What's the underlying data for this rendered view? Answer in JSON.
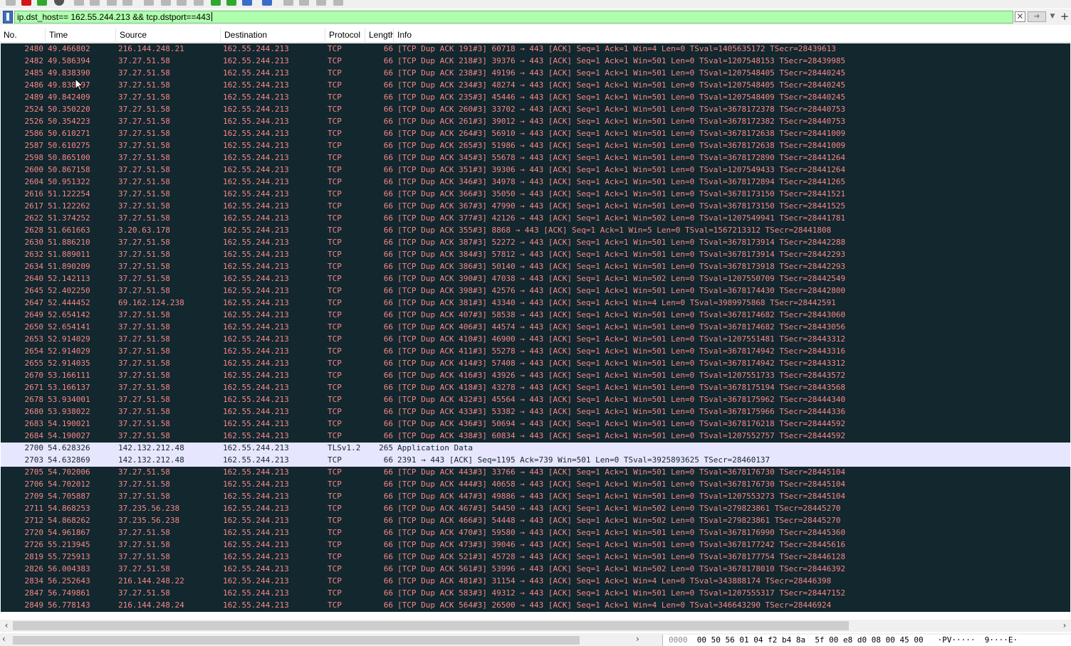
{
  "filter": {
    "value": "ip.dst_host== 162.55.244.213 && tcp.dstport==443",
    "bookmark_icon": "bookmark-icon",
    "clear_icon": "clear-icon",
    "apply_icon": "arrow-right-icon",
    "dropdown_icon": "chevron-down-icon",
    "add_icon": "plus-icon",
    "color": "#afffaf"
  },
  "columns": [
    "No.",
    "Time",
    "Source",
    "Destination",
    "Protocol",
    "Length",
    "Info"
  ],
  "colors": {
    "bad_tcp_bg": "#12272e",
    "bad_tcp_fg": "#f78787",
    "normal_bg": "#e7e6ff",
    "normal_fg": "#12272e"
  },
  "packets": [
    {
      "no": "2480",
      "time": "49.466802",
      "src": "216.144.248.21",
      "dst": "162.55.244.213",
      "proto": "TCP",
      "len": "66",
      "info": "[TCP Dup ACK 191#3] 60718 → 443 [ACK] Seq=1 Ack=1 Win=4 Len=0 TSval=1405635172 TSecr=28439613",
      "style": "bad"
    },
    {
      "no": "2482",
      "time": "49.586394",
      "src": "37.27.51.58",
      "dst": "162.55.244.213",
      "proto": "TCP",
      "len": "66",
      "info": "[TCP Dup ACK 218#3] 39376 → 443 [ACK] Seq=1 Ack=1 Win=501 Len=0 TSval=1207548153 TSecr=28439985",
      "style": "bad"
    },
    {
      "no": "2485",
      "time": "49.838390",
      "src": "37.27.51.58",
      "dst": "162.55.244.213",
      "proto": "TCP",
      "len": "66",
      "info": "[TCP Dup ACK 238#3] 49196 → 443 [ACK] Seq=1 Ack=1 Win=501 Len=0 TSval=1207548405 TSecr=28440245",
      "style": "bad"
    },
    {
      "no": "2486",
      "time": "49.838397",
      "src": "37.27.51.58",
      "dst": "162.55.244.213",
      "proto": "TCP",
      "len": "66",
      "info": "[TCP Dup ACK 234#3] 48274 → 443 [ACK] Seq=1 Ack=1 Win=501 Len=0 TSval=1207548405 TSecr=28440245",
      "style": "bad"
    },
    {
      "no": "2489",
      "time": "49.842409",
      "src": "37.27.51.58",
      "dst": "162.55.244.213",
      "proto": "TCP",
      "len": "66",
      "info": "[TCP Dup ACK 235#3] 45446 → 443 [ACK] Seq=1 Ack=1 Win=501 Len=0 TSval=1207548409 TSecr=28440245",
      "style": "bad"
    },
    {
      "no": "2524",
      "time": "50.350220",
      "src": "37.27.51.58",
      "dst": "162.55.244.213",
      "proto": "TCP",
      "len": "66",
      "info": "[TCP Dup ACK 260#3] 33702 → 443 [ACK] Seq=1 Ack=1 Win=501 Len=0 TSval=3678172378 TSecr=28440753",
      "style": "bad"
    },
    {
      "no": "2526",
      "time": "50.354223",
      "src": "37.27.51.58",
      "dst": "162.55.244.213",
      "proto": "TCP",
      "len": "66",
      "info": "[TCP Dup ACK 261#3] 39012 → 443 [ACK] Seq=1 Ack=1 Win=501 Len=0 TSval=3678172382 TSecr=28440753",
      "style": "bad"
    },
    {
      "no": "2586",
      "time": "50.610271",
      "src": "37.27.51.58",
      "dst": "162.55.244.213",
      "proto": "TCP",
      "len": "66",
      "info": "[TCP Dup ACK 264#3] 56910 → 443 [ACK] Seq=1 Ack=1 Win=501 Len=0 TSval=3678172638 TSecr=28441009",
      "style": "bad"
    },
    {
      "no": "2587",
      "time": "50.610275",
      "src": "37.27.51.58",
      "dst": "162.55.244.213",
      "proto": "TCP",
      "len": "66",
      "info": "[TCP Dup ACK 265#3] 51986 → 443 [ACK] Seq=1 Ack=1 Win=501 Len=0 TSval=3678172638 TSecr=28441009",
      "style": "bad"
    },
    {
      "no": "2598",
      "time": "50.865100",
      "src": "37.27.51.58",
      "dst": "162.55.244.213",
      "proto": "TCP",
      "len": "66",
      "info": "[TCP Dup ACK 345#3] 55678 → 443 [ACK] Seq=1 Ack=1 Win=501 Len=0 TSval=3678172890 TSecr=28441264",
      "style": "bad"
    },
    {
      "no": "2600",
      "time": "50.867158",
      "src": "37.27.51.58",
      "dst": "162.55.244.213",
      "proto": "TCP",
      "len": "66",
      "info": "[TCP Dup ACK 351#3] 39306 → 443 [ACK] Seq=1 Ack=1 Win=501 Len=0 TSval=1207549433 TSecr=28441264",
      "style": "bad"
    },
    {
      "no": "2604",
      "time": "50.951322",
      "src": "37.27.51.58",
      "dst": "162.55.244.213",
      "proto": "TCP",
      "len": "66",
      "info": "[TCP Dup ACK 346#3] 34978 → 443 [ACK] Seq=1 Ack=1 Win=501 Len=0 TSval=3678172894 TSecr=28441265",
      "style": "bad"
    },
    {
      "no": "2616",
      "time": "51.122254",
      "src": "37.27.51.58",
      "dst": "162.55.244.213",
      "proto": "TCP",
      "len": "66",
      "info": "[TCP Dup ACK 366#3] 35050 → 443 [ACK] Seq=1 Ack=1 Win=501 Len=0 TSval=3678173150 TSecr=28441521",
      "style": "bad"
    },
    {
      "no": "2617",
      "time": "51.122262",
      "src": "37.27.51.58",
      "dst": "162.55.244.213",
      "proto": "TCP",
      "len": "66",
      "info": "[TCP Dup ACK 367#3] 47990 → 443 [ACK] Seq=1 Ack=1 Win=501 Len=0 TSval=3678173150 TSecr=28441525",
      "style": "bad"
    },
    {
      "no": "2622",
      "time": "51.374252",
      "src": "37.27.51.58",
      "dst": "162.55.244.213",
      "proto": "TCP",
      "len": "66",
      "info": "[TCP Dup ACK 377#3] 42126 → 443 [ACK] Seq=1 Ack=1 Win=502 Len=0 TSval=1207549941 TSecr=28441781",
      "style": "bad"
    },
    {
      "no": "2628",
      "time": "51.661663",
      "src": "3.20.63.178",
      "dst": "162.55.244.213",
      "proto": "TCP",
      "len": "66",
      "info": "[TCP Dup ACK 355#3] 8868 → 443 [ACK] Seq=1 Ack=1 Win=5 Len=0 TSval=1567213312 TSecr=28441808",
      "style": "bad"
    },
    {
      "no": "2630",
      "time": "51.886210",
      "src": "37.27.51.58",
      "dst": "162.55.244.213",
      "proto": "TCP",
      "len": "66",
      "info": "[TCP Dup ACK 387#3] 52272 → 443 [ACK] Seq=1 Ack=1 Win=501 Len=0 TSval=3678173914 TSecr=28442288",
      "style": "bad"
    },
    {
      "no": "2632",
      "time": "51.889011",
      "src": "37.27.51.58",
      "dst": "162.55.244.213",
      "proto": "TCP",
      "len": "66",
      "info": "[TCP Dup ACK 384#3] 57812 → 443 [ACK] Seq=1 Ack=1 Win=501 Len=0 TSval=3678173914 TSecr=28442293",
      "style": "bad"
    },
    {
      "no": "2634",
      "time": "51.890209",
      "src": "37.27.51.58",
      "dst": "162.55.244.213",
      "proto": "TCP",
      "len": "66",
      "info": "[TCP Dup ACK 386#3] 50140 → 443 [ACK] Seq=1 Ack=1 Win=501 Len=0 TSval=3678173918 TSecr=28442293",
      "style": "bad"
    },
    {
      "no": "2640",
      "time": "52.142113",
      "src": "37.27.51.58",
      "dst": "162.55.244.213",
      "proto": "TCP",
      "len": "66",
      "info": "[TCP Dup ACK 390#3] 47038 → 443 [ACK] Seq=1 Ack=1 Win=502 Len=0 TSval=1207550709 TSecr=28442549",
      "style": "bad"
    },
    {
      "no": "2645",
      "time": "52.402250",
      "src": "37.27.51.58",
      "dst": "162.55.244.213",
      "proto": "TCP",
      "len": "66",
      "info": "[TCP Dup ACK 398#3] 42576 → 443 [ACK] Seq=1 Ack=1 Win=501 Len=0 TSval=3678174430 TSecr=28442800",
      "style": "bad"
    },
    {
      "no": "2647",
      "time": "52.444452",
      "src": "69.162.124.238",
      "dst": "162.55.244.213",
      "proto": "TCP",
      "len": "66",
      "info": "[TCP Dup ACK 381#3] 43340 → 443 [ACK] Seq=1 Ack=1 Win=4 Len=0 TSval=3989975868 TSecr=28442591",
      "style": "bad"
    },
    {
      "no": "2649",
      "time": "52.654142",
      "src": "37.27.51.58",
      "dst": "162.55.244.213",
      "proto": "TCP",
      "len": "66",
      "info": "[TCP Dup ACK 407#3] 58538 → 443 [ACK] Seq=1 Ack=1 Win=501 Len=0 TSval=3678174682 TSecr=28443060",
      "style": "bad"
    },
    {
      "no": "2650",
      "time": "52.654141",
      "src": "37.27.51.58",
      "dst": "162.55.244.213",
      "proto": "TCP",
      "len": "66",
      "info": "[TCP Dup ACK 406#3] 44574 → 443 [ACK] Seq=1 Ack=1 Win=501 Len=0 TSval=3678174682 TSecr=28443056",
      "style": "bad"
    },
    {
      "no": "2653",
      "time": "52.914029",
      "src": "37.27.51.58",
      "dst": "162.55.244.213",
      "proto": "TCP",
      "len": "66",
      "info": "[TCP Dup ACK 410#3] 46900 → 443 [ACK] Seq=1 Ack=1 Win=501 Len=0 TSval=1207551481 TSecr=28443312",
      "style": "bad"
    },
    {
      "no": "2654",
      "time": "52.914029",
      "src": "37.27.51.58",
      "dst": "162.55.244.213",
      "proto": "TCP",
      "len": "66",
      "info": "[TCP Dup ACK 411#3] 55278 → 443 [ACK] Seq=1 Ack=1 Win=501 Len=0 TSval=3678174942 TSecr=28443316",
      "style": "bad"
    },
    {
      "no": "2655",
      "time": "52.914035",
      "src": "37.27.51.58",
      "dst": "162.55.244.213",
      "proto": "TCP",
      "len": "66",
      "info": "[TCP Dup ACK 414#3] 57408 → 443 [ACK] Seq=1 Ack=1 Win=501 Len=0 TSval=3678174942 TSecr=28443312",
      "style": "bad"
    },
    {
      "no": "2670",
      "time": "53.166111",
      "src": "37.27.51.58",
      "dst": "162.55.244.213",
      "proto": "TCP",
      "len": "66",
      "info": "[TCP Dup ACK 416#3] 43926 → 443 [ACK] Seq=1 Ack=1 Win=501 Len=0 TSval=1207551733 TSecr=28443572",
      "style": "bad"
    },
    {
      "no": "2671",
      "time": "53.166137",
      "src": "37.27.51.58",
      "dst": "162.55.244.213",
      "proto": "TCP",
      "len": "66",
      "info": "[TCP Dup ACK 418#3] 43278 → 443 [ACK] Seq=1 Ack=1 Win=501 Len=0 TSval=3678175194 TSecr=28443568",
      "style": "bad"
    },
    {
      "no": "2678",
      "time": "53.934001",
      "src": "37.27.51.58",
      "dst": "162.55.244.213",
      "proto": "TCP",
      "len": "66",
      "info": "[TCP Dup ACK 432#3] 45564 → 443 [ACK] Seq=1 Ack=1 Win=501 Len=0 TSval=3678175962 TSecr=28444340",
      "style": "bad"
    },
    {
      "no": "2680",
      "time": "53.938022",
      "src": "37.27.51.58",
      "dst": "162.55.244.213",
      "proto": "TCP",
      "len": "66",
      "info": "[TCP Dup ACK 433#3] 53382 → 443 [ACK] Seq=1 Ack=1 Win=501 Len=0 TSval=3678175966 TSecr=28444336",
      "style": "bad"
    },
    {
      "no": "2683",
      "time": "54.190021",
      "src": "37.27.51.58",
      "dst": "162.55.244.213",
      "proto": "TCP",
      "len": "66",
      "info": "[TCP Dup ACK 436#3] 50694 → 443 [ACK] Seq=1 Ack=1 Win=501 Len=0 TSval=3678176218 TSecr=28444592",
      "style": "bad"
    },
    {
      "no": "2684",
      "time": "54.190027",
      "src": "37.27.51.58",
      "dst": "162.55.244.213",
      "proto": "TCP",
      "len": "66",
      "info": "[TCP Dup ACK 438#3] 60834 → 443 [ACK] Seq=1 Ack=1 Win=501 Len=0 TSval=1207552757 TSecr=28444592",
      "style": "bad"
    },
    {
      "no": "2700",
      "time": "54.628326",
      "src": "142.132.212.48",
      "dst": "162.55.244.213",
      "proto": "TLSv1.2",
      "len": "265",
      "info": "Application Data",
      "style": "normal"
    },
    {
      "no": "2703",
      "time": "54.632869",
      "src": "142.132.212.48",
      "dst": "162.55.244.213",
      "proto": "TCP",
      "len": "66",
      "info": "2391 → 443 [ACK] Seq=1195 Ack=739 Win=501 Len=0 TSval=3925893625 TSecr=28460137",
      "style": "normal"
    },
    {
      "no": "2705",
      "time": "54.702006",
      "src": "37.27.51.58",
      "dst": "162.55.244.213",
      "proto": "TCP",
      "len": "66",
      "info": "[TCP Dup ACK 443#3] 33766 → 443 [ACK] Seq=1 Ack=1 Win=501 Len=0 TSval=3678176730 TSecr=28445104",
      "style": "bad"
    },
    {
      "no": "2706",
      "time": "54.702012",
      "src": "37.27.51.58",
      "dst": "162.55.244.213",
      "proto": "TCP",
      "len": "66",
      "info": "[TCP Dup ACK 444#3] 40658 → 443 [ACK] Seq=1 Ack=1 Win=501 Len=0 TSval=3678176730 TSecr=28445104",
      "style": "bad"
    },
    {
      "no": "2709",
      "time": "54.705887",
      "src": "37.27.51.58",
      "dst": "162.55.244.213",
      "proto": "TCP",
      "len": "66",
      "info": "[TCP Dup ACK 447#3] 49886 → 443 [ACK] Seq=1 Ack=1 Win=501 Len=0 TSval=1207553273 TSecr=28445104",
      "style": "bad"
    },
    {
      "no": "2711",
      "time": "54.868253",
      "src": "37.235.56.238",
      "dst": "162.55.244.213",
      "proto": "TCP",
      "len": "66",
      "info": "[TCP Dup ACK 467#3] 54450 → 443 [ACK] Seq=1 Ack=1 Win=502 Len=0 TSval=279823861 TSecr=28445270",
      "style": "bad"
    },
    {
      "no": "2712",
      "time": "54.868262",
      "src": "37.235.56.238",
      "dst": "162.55.244.213",
      "proto": "TCP",
      "len": "66",
      "info": "[TCP Dup ACK 466#3] 54448 → 443 [ACK] Seq=1 Ack=1 Win=502 Len=0 TSval=279823861 TSecr=28445270",
      "style": "bad"
    },
    {
      "no": "2720",
      "time": "54.961867",
      "src": "37.27.51.58",
      "dst": "162.55.244.213",
      "proto": "TCP",
      "len": "66",
      "info": "[TCP Dup ACK 470#3] 59580 → 443 [ACK] Seq=1 Ack=1 Win=501 Len=0 TSval=3678176990 TSecr=28445360",
      "style": "bad"
    },
    {
      "no": "2726",
      "time": "55.213945",
      "src": "37.27.51.58",
      "dst": "162.55.244.213",
      "proto": "TCP",
      "len": "66",
      "info": "[TCP Dup ACK 473#3] 39046 → 443 [ACK] Seq=1 Ack=1 Win=501 Len=0 TSval=3678177242 TSecr=28445616",
      "style": "bad"
    },
    {
      "no": "2819",
      "time": "55.725913",
      "src": "37.27.51.58",
      "dst": "162.55.244.213",
      "proto": "TCP",
      "len": "66",
      "info": "[TCP Dup ACK 521#3] 45728 → 443 [ACK] Seq=1 Ack=1 Win=501 Len=0 TSval=3678177754 TSecr=28446128",
      "style": "bad"
    },
    {
      "no": "2826",
      "time": "56.004383",
      "src": "37.27.51.58",
      "dst": "162.55.244.213",
      "proto": "TCP",
      "len": "66",
      "info": "[TCP Dup ACK 561#3] 53996 → 443 [ACK] Seq=1 Ack=1 Win=502 Len=0 TSval=3678178010 TSecr=28446392",
      "style": "bad"
    },
    {
      "no": "2834",
      "time": "56.252643",
      "src": "216.144.248.22",
      "dst": "162.55.244.213",
      "proto": "TCP",
      "len": "66",
      "info": "[TCP Dup ACK 481#3] 31154 → 443 [ACK] Seq=1 Ack=1 Win=4 Len=0 TSval=343888174 TSecr=28446398",
      "style": "bad"
    },
    {
      "no": "2847",
      "time": "56.749861",
      "src": "37.27.51.58",
      "dst": "162.55.244.213",
      "proto": "TCP",
      "len": "66",
      "info": "[TCP Dup ACK 583#3] 49312 → 443 [ACK] Seq=1 Ack=1 Win=501 Len=0 TSval=1207555317 TSecr=28447152",
      "style": "bad"
    },
    {
      "no": "2849",
      "time": "56.778143",
      "src": "216.144.248.24",
      "dst": "162.55.244.213",
      "proto": "TCP",
      "len": "66",
      "info": "[TCP Dup ACK 564#3] 26500 → 443 [ACK] Seq=1 Ack=1 Win=4 Len=0 TSval=346643290 TSecr=28446924",
      "style": "bad"
    }
  ],
  "scrollbar": {
    "left_arrow": "‹",
    "right_arrow": "›"
  },
  "bytes_pane": {
    "offset": "0000",
    "hex": "00 50 56 01 04 f2 b4 8a  5f 00 e8 d0 08 00 45 00",
    "ascii": "·PV·····  9····E·"
  }
}
